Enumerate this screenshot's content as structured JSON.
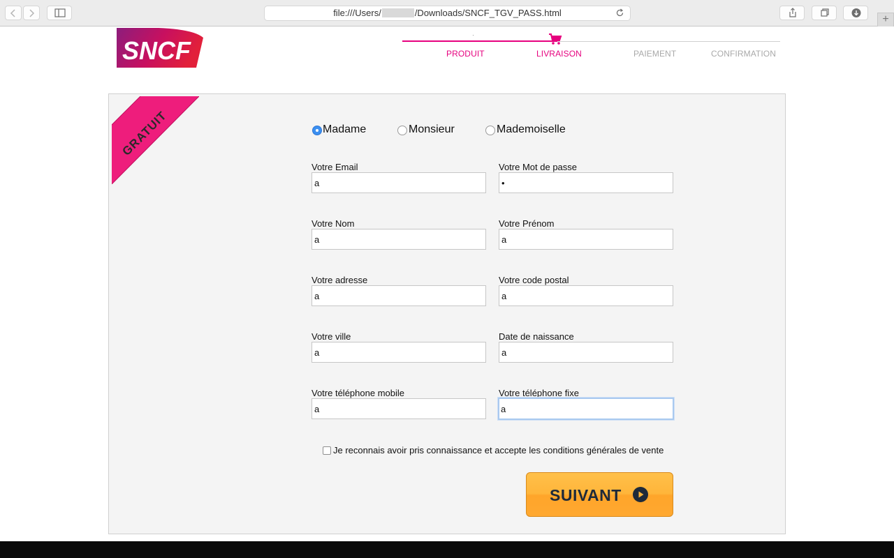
{
  "browser": {
    "url_prefix": "file:///Users/",
    "url_suffix": "/Downloads/SNCF_TGV_PASS.html",
    "back_icon": "chevron-left-icon",
    "forward_icon": "chevron-right-icon",
    "plus_label": "+"
  },
  "header": {
    "logo_text": "SNCF",
    "steps": [
      {
        "label": "PRODUIT",
        "state": "active"
      },
      {
        "label": "LIVRAISON",
        "state": "active"
      },
      {
        "label": "PAIEMENT",
        "state": "inactive"
      },
      {
        "label": "CONFIRMATION",
        "state": "inactive"
      }
    ],
    "accent_color": "#e6007e"
  },
  "form": {
    "ribbon_text": "GRATUIT",
    "civility": {
      "options": [
        "Madame",
        "Monsieur",
        "Mademoiselle"
      ],
      "selected": "Madame"
    },
    "fields": {
      "email": {
        "label": "Votre Email",
        "value": "a"
      },
      "password": {
        "label": "Votre Mot de passe",
        "value": "a"
      },
      "nom": {
        "label": "Votre Nom",
        "value": "a"
      },
      "prenom": {
        "label": "Votre Prénom",
        "value": "a"
      },
      "adresse": {
        "label": "Votre adresse",
        "value": "a"
      },
      "code_postal": {
        "label": "Votre code postal",
        "value": "a"
      },
      "ville": {
        "label": "Votre ville",
        "value": "a"
      },
      "naissance": {
        "label": "Date de naissance",
        "value": "a"
      },
      "mobile": {
        "label": "Votre téléphone mobile",
        "value": "a"
      },
      "fixe": {
        "label": "Votre téléphone fixe",
        "value": "a"
      }
    },
    "cgv_label": "Je reconnais avoir pris connaissance et accepte les conditions générales de vente",
    "cgv_checked": false,
    "submit_label": "SUIVANT"
  }
}
